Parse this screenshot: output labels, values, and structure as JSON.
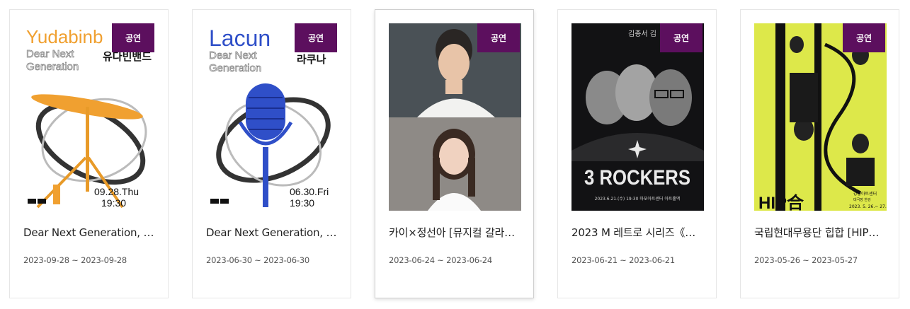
{
  "cards": [
    {
      "category": "공연",
      "title": "Dear Next Generation, 유…",
      "dates": "2023-09-28 ~ 2023-09-28",
      "poster": {
        "brand": "Yudabinb",
        "subtitle1": "Dear Next",
        "subtitle2": "Generation",
        "korean": "유다빈밴드",
        "date": "09.28.Thu",
        "time": "19:30",
        "accent": "#f0a030"
      }
    },
    {
      "category": "공연",
      "title": "Dear Next Generation, 라…",
      "dates": "2023-06-30 ~ 2023-06-30",
      "poster": {
        "brand": "Lacun",
        "subtitle1": "Dear Next",
        "subtitle2": "Generation",
        "korean": "라쿠나",
        "date": "06.30.Fri",
        "time": "19:30",
        "accent": "#2f4fc8"
      }
    },
    {
      "category": "공연",
      "title": "카이×정선아 [뮤지컬 갈라…",
      "dates": "2023-06-24 ~ 2023-06-24"
    },
    {
      "category": "공연",
      "title": "2023 M 레트로 시리즈《…",
      "dates": "2023-06-21 ~ 2023-06-21",
      "poster": {
        "headline": "3 ROCKERS",
        "names": "김종서 김",
        "footer": "2023.6.21.(수) 19:30 마포아트센터 아트홀맥"
      }
    },
    {
      "category": "공연",
      "title": "국립현대무용단 힙합 [HIP…",
      "dates": "2023-05-26 ~ 2023-05-27",
      "poster": {
        "headline": "HIP合",
        "venue1": "강동아트센터",
        "venue2": "대극장 한강",
        "footer": "2023. 5. 26.~ 27."
      }
    }
  ],
  "colors": {
    "badge": "#5c0f5e",
    "poster5_bg": "#dde84a"
  }
}
